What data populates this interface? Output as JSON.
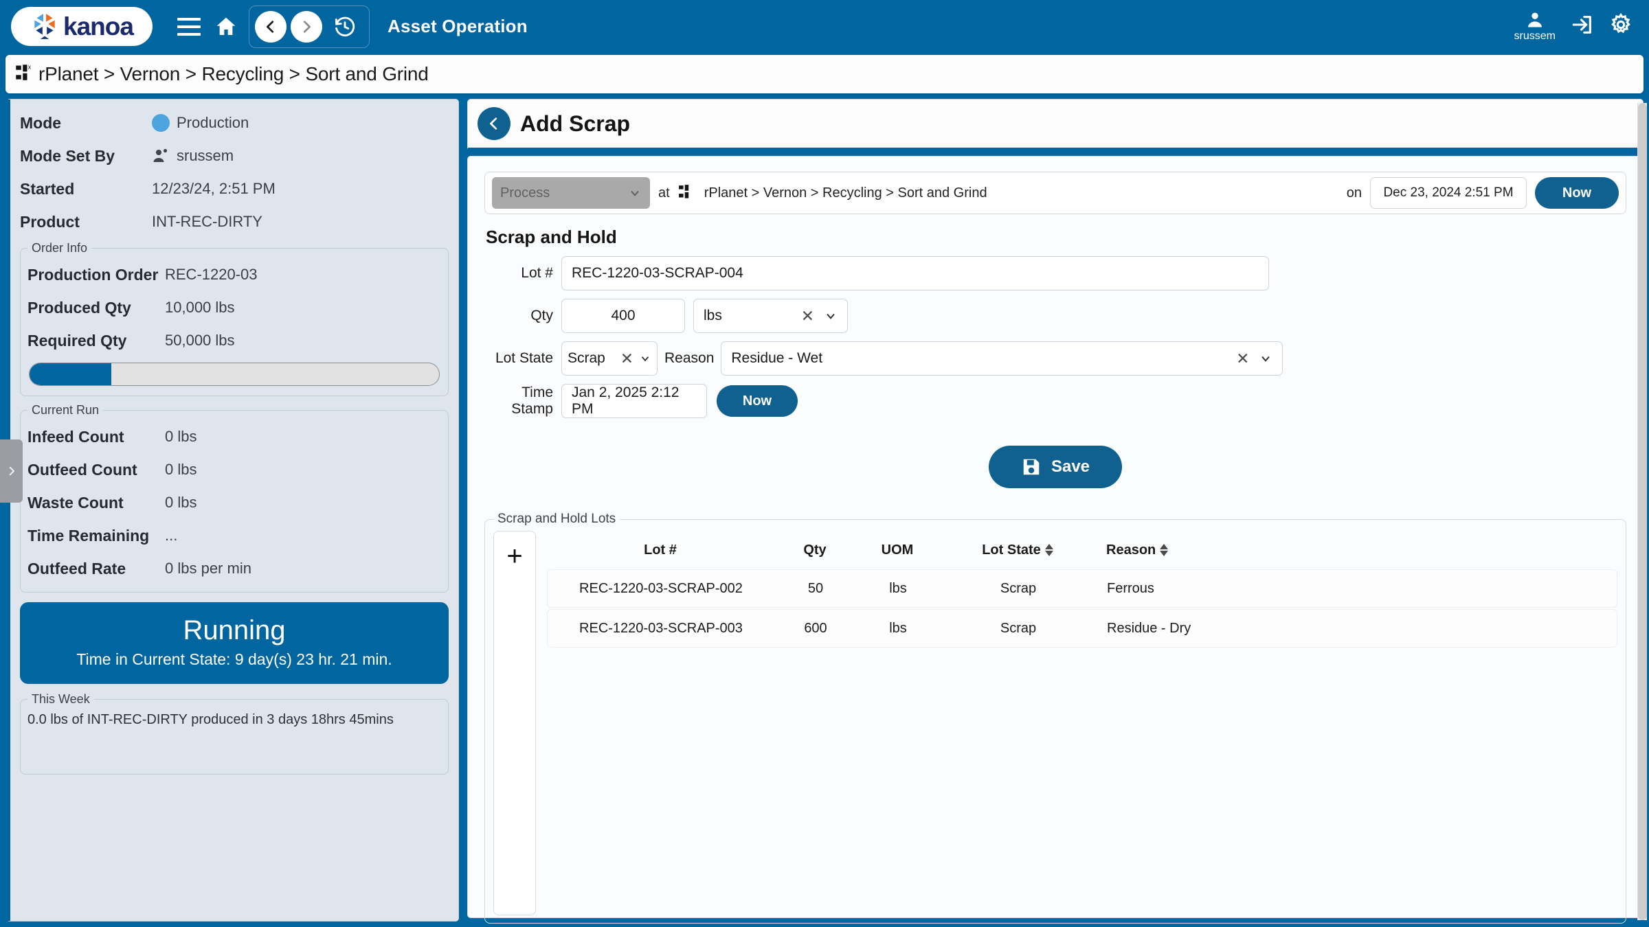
{
  "app": {
    "brand": "kanoa",
    "title": "Asset Operation",
    "user": "srussem"
  },
  "icons": {
    "hamburger": "menu-icon",
    "home": "home-icon",
    "back": "back-chevron-icon",
    "forward": "forward-chevron-icon",
    "history": "history-clock-icon",
    "account": "user-account-icon",
    "logout": "logout-icon",
    "settings": "gear-icon",
    "asset": "asset-hierarchy-icon",
    "save": "floppy-disk-icon",
    "add": "plus-icon",
    "clear": "clear-x-icon",
    "dropdown": "chevron-down-icon",
    "collapse": "collapse-panel-chevron-icon"
  },
  "breadcrumb": {
    "text": "rPlanet > Vernon > Recycling > Sort and Grind"
  },
  "left_panel": {
    "rows": [
      {
        "label": "Mode",
        "value": "Production"
      },
      {
        "label": "Mode Set By",
        "value": "srussem"
      },
      {
        "label": "Started",
        "value": "12/23/24, 2:51 PM"
      },
      {
        "label": "Product",
        "value": "INT-REC-DIRTY"
      }
    ],
    "order_info": {
      "legend": "Order Info",
      "rows": [
        {
          "label": "Production Order",
          "value": "REC-1220-03"
        },
        {
          "label": "Produced Qty",
          "value": "10,000 lbs"
        },
        {
          "label": "Required Qty",
          "value": "50,000 lbs"
        }
      ],
      "progress_percent": 20
    },
    "current_run": {
      "legend": "Current Run",
      "rows": [
        {
          "label": "Infeed Count",
          "value": "0 lbs"
        },
        {
          "label": "Outfeed Count",
          "value": "0 lbs"
        },
        {
          "label": "Waste Count",
          "value": "0 lbs"
        },
        {
          "label": "Time Remaining",
          "value": "..."
        },
        {
          "label": "Outfeed Rate",
          "value": "0 lbs per min"
        }
      ]
    },
    "state_card": {
      "state": "Running",
      "time_in_state": "Time in Current State: 9 day(s) 23 hr. 21 min."
    },
    "this_week": {
      "legend": "This Week",
      "text": "0.0 lbs of INT-REC-DIRTY produced in 3 days 18hrs 45mins"
    }
  },
  "right_panel": {
    "title": "Add Scrap",
    "context": {
      "process_placeholder": "Process",
      "at_label": "at",
      "path": "rPlanet > Vernon > Recycling > Sort and Grind",
      "on_label": "on",
      "datetime": "Dec 23, 2024 2:51 PM",
      "now_label": "Now"
    },
    "form": {
      "section_title": "Scrap and Hold",
      "lot_label": "Lot #",
      "lot_value": "REC-1220-03-SCRAP-004",
      "qty_label": "Qty",
      "qty_value": "400",
      "uom_value": "lbs",
      "lot_state_label": "Lot State",
      "lot_state_value": "Scrap",
      "reason_label": "Reason",
      "reason_value": "Residue - Wet",
      "timestamp_label": "Time Stamp",
      "timestamp_value": "Jan 2, 2025 2:12 PM",
      "timestamp_now_label": "Now",
      "save_label": "Save"
    },
    "lots_table": {
      "legend": "Scrap and Hold Lots",
      "columns": [
        "Lot #",
        "Qty",
        "UOM",
        "Lot State",
        "Reason"
      ],
      "sortable": [
        "Lot State",
        "Reason"
      ],
      "rows": [
        {
          "lot": "REC-1220-03-SCRAP-002",
          "qty": "50",
          "uom": "lbs",
          "state": "Scrap",
          "reason": "Ferrous"
        },
        {
          "lot": "REC-1220-03-SCRAP-003",
          "qty": "600",
          "uom": "lbs",
          "state": "Scrap",
          "reason": "Residue - Dry"
        }
      ]
    }
  },
  "colors": {
    "brand_blue": "#01659f",
    "accent_blue": "#10618f",
    "panel_gray": "#dfe5ed",
    "mode_dot": "#4da3dd",
    "logo_navy": "#1b2a6b",
    "logo_orange": "#ee6a1e"
  }
}
